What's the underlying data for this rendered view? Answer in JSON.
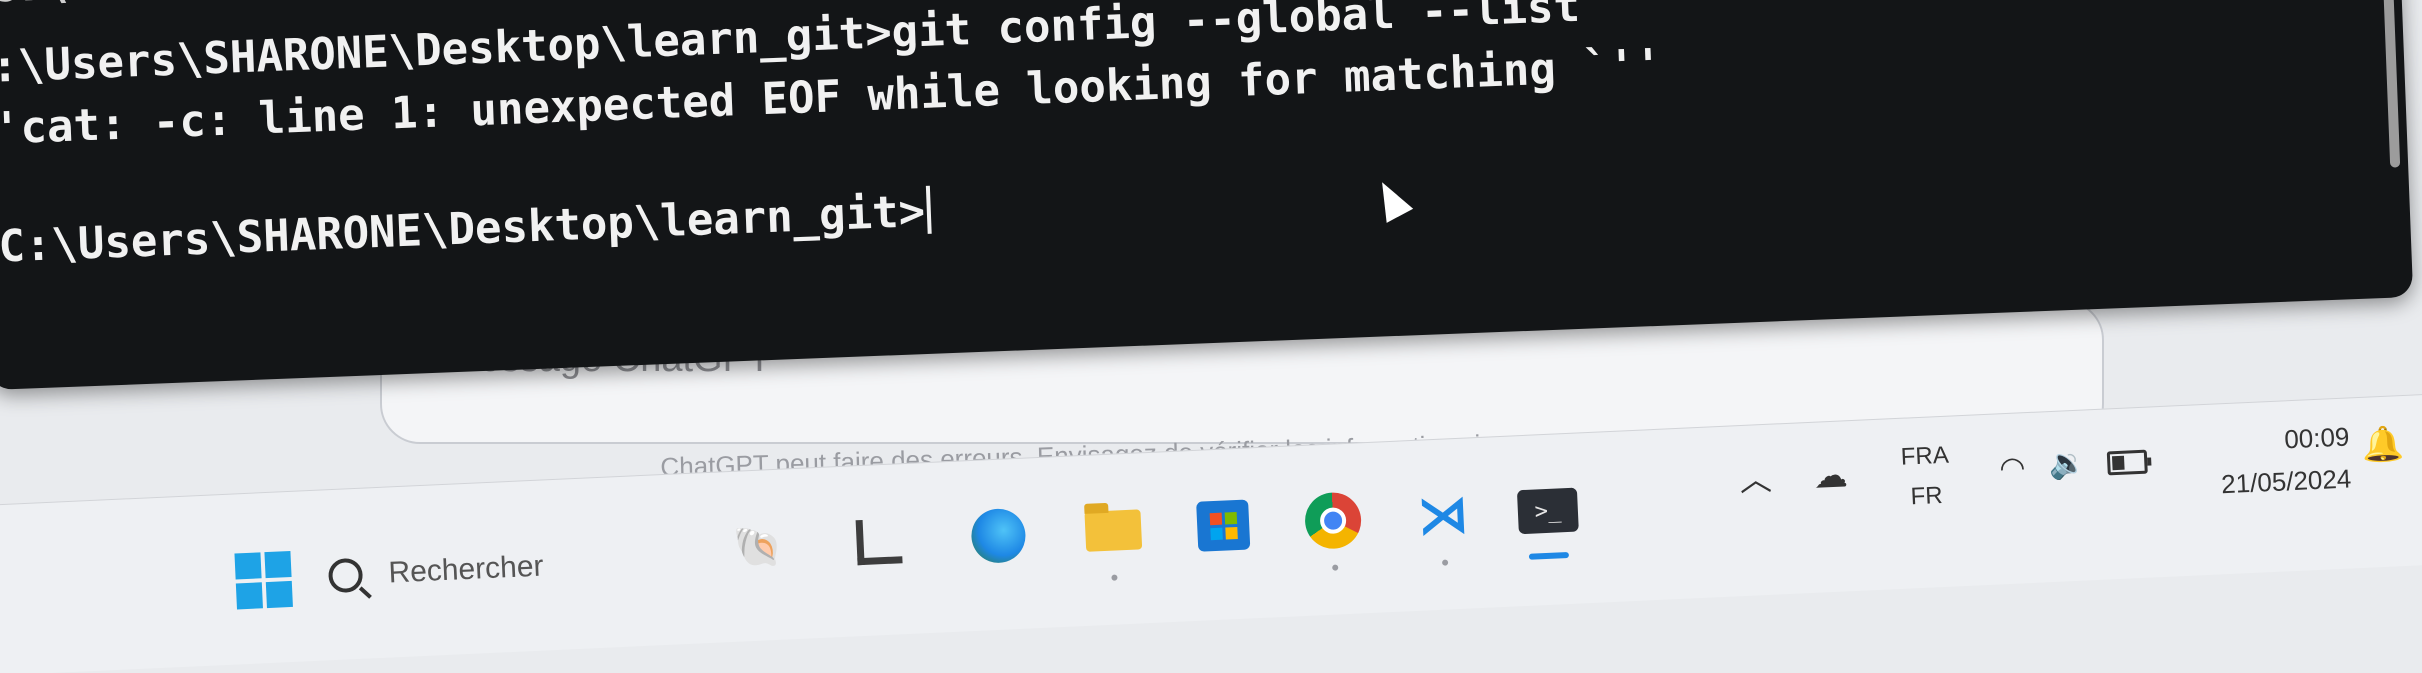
{
  "terminal": {
    "lines": [
      "C:\\Users\\SHARONE",
      ":\\Users\\SHARONE\\Desktop\\learn_git>git config --global --list",
      "'cat: -c: line 1: unexpected EOF while looking for matching `''",
      "C:\\Users\\SHARONE\\Desktop\\learn_git>"
    ]
  },
  "chat": {
    "placeholder": "Message ChatGPT",
    "disclaimer": "ChatGPT peut faire des erreurs. Envisagez de vérifier les informations importantes."
  },
  "taskbar": {
    "search_placeholder": "Rechercher",
    "apps": [
      "widgets",
      "file-explorer-lite",
      "edge",
      "file-explorer",
      "microsoft-store",
      "chrome",
      "vscode",
      "terminal"
    ],
    "tray": {
      "language_primary": "FRA",
      "language_secondary": "FR",
      "time": "00:09",
      "date": "21/05/2024"
    }
  },
  "colors": {
    "terminal_bg": "#131517",
    "terminal_text": "#f1f1f1",
    "taskbar_bg": "#eef0f3",
    "accent": "#1e88e5"
  }
}
